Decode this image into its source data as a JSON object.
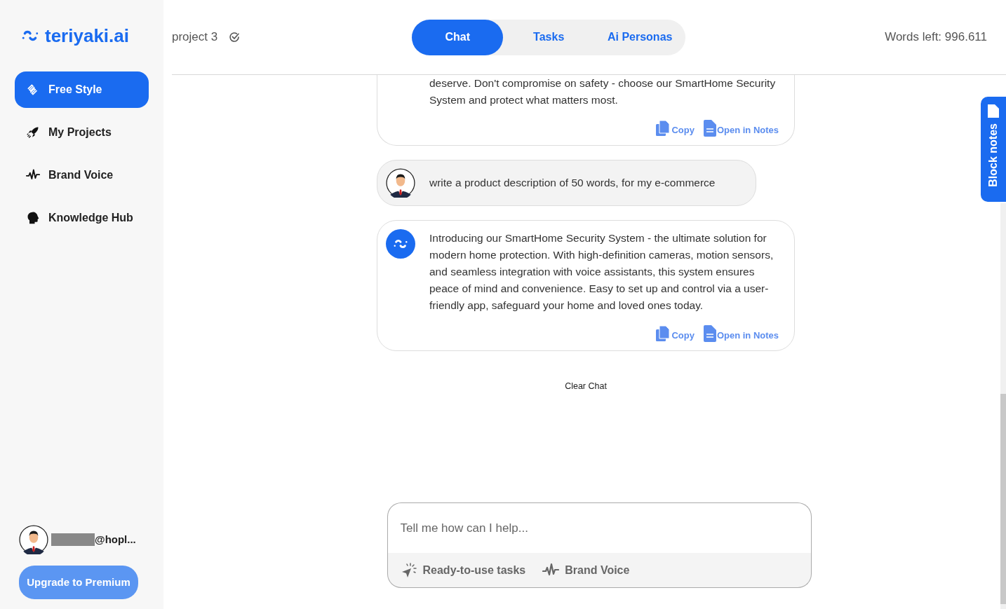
{
  "logo": {
    "text": "teriyaki.ai"
  },
  "sidebar": {
    "items": [
      {
        "label": "Free Style",
        "selected": true
      },
      {
        "label": "My Projects",
        "selected": false
      },
      {
        "label": "Brand Voice",
        "selected": false
      },
      {
        "label": "Knowledge Hub",
        "selected": false
      }
    ]
  },
  "user": {
    "email": "@hopl..."
  },
  "upgrade_button": "Upgrade to Premium",
  "project": {
    "title": "project 3"
  },
  "tabs": [
    {
      "label": "Chat",
      "selected": true
    },
    {
      "label": "Tasks",
      "selected": false
    },
    {
      "label": "Ai Personas",
      "selected": false
    }
  ],
  "words_left": "Words left: 996.611",
  "messages": [
    {
      "kind": "ai",
      "avatar": false,
      "text": "deserve. Don't compromise on safety - choose our SmartHome Security System and protect what matters most.",
      "actions": [
        "Copy",
        "Open in Notes"
      ]
    },
    {
      "kind": "user",
      "avatar": true,
      "text": "write a product description of 50 words, for my e-commerce"
    },
    {
      "kind": "ai",
      "avatar": true,
      "text": "Introducing our SmartHome Security System - the ultimate solution for modern home protection. With high-definition cameras, motion sensors, and seamless integration with voice assistants, this system ensures peace of mind and convenience. Easy to set up and control via a user-friendly app, safeguard your home and loved ones today.",
      "actions": [
        "Copy",
        "Open in Notes"
      ]
    }
  ],
  "clear_chat": "Clear Chat",
  "composer": {
    "placeholder": "Tell me how can I help...",
    "tools": [
      "Ready-to-use tasks",
      "Brand Voice"
    ]
  },
  "block_notes": "Block notes"
}
